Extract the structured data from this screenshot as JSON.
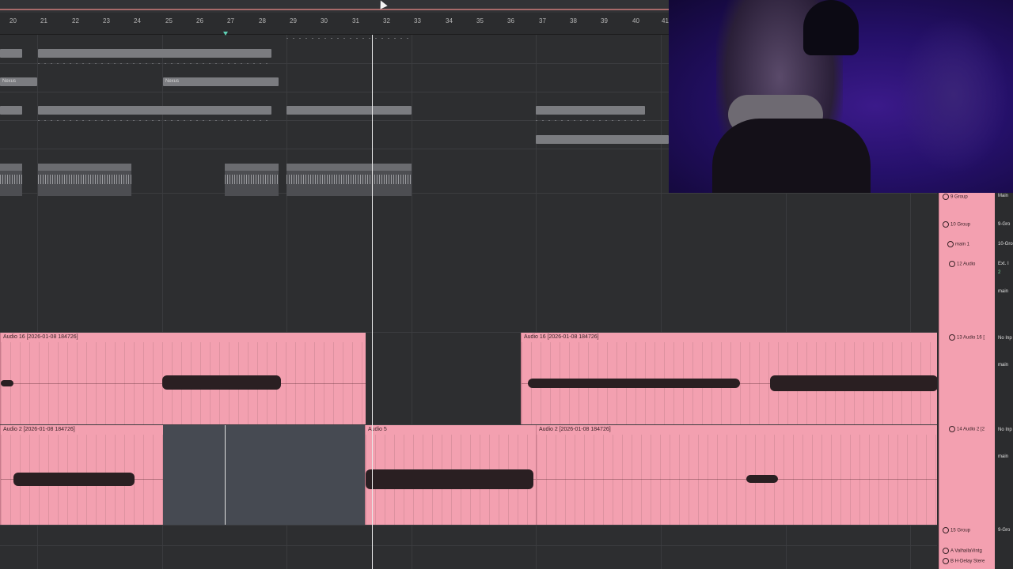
{
  "ruler": {
    "bars": [
      "20",
      "21",
      "22",
      "23",
      "24",
      "25",
      "26",
      "27",
      "28",
      "29",
      "30",
      "31",
      "32",
      "33",
      "34",
      "35",
      "36",
      "37",
      "38",
      "39",
      "40",
      "41"
    ]
  },
  "grey_clips": [
    {
      "label": "Nexus"
    },
    {
      "label": "Nexus"
    }
  ],
  "drum_clips": [
    {
      "label": "clasy"
    },
    {
      "label": "clasy_101_drumloop_90bpm_Re"
    },
    {
      "label": "clasy_101_drumlo"
    },
    {
      "label": "clasy_101_drumloop_100bpm_fersceclipsis"
    }
  ],
  "audio_clips": [
    {
      "label": "Audio 16 [2026-01-08 184726]"
    },
    {
      "label": "Audio 16 [2026-01-08 184726]"
    },
    {
      "label": "Audio 2 [2026-01-08 184726]"
    },
    {
      "label": "Audio 5"
    },
    {
      "label": "Audio 2 [2026-01-08 184726]"
    }
  ],
  "mixer": {
    "tracks": [
      {
        "label": "9 Group"
      },
      {
        "label": "10 Group"
      },
      {
        "label": "main 1"
      },
      {
        "label": "12 Audio"
      },
      {
        "label": "13 Audio 16 ["
      },
      {
        "label": "14 Audio 2 [2"
      },
      {
        "label": "15 Group"
      },
      {
        "label": "A ValhallaVintg"
      },
      {
        "label": "B H-Delay Stere"
      }
    ],
    "io": [
      "Main",
      "9-Gro",
      "10-Gro",
      "Ext. I",
      "2",
      "main",
      "No Inp",
      "main",
      "No Inp",
      "main",
      "9-Gro"
    ]
  },
  "colors": {
    "audio_clip": "#f3a0b0",
    "playhead": "#e8e8e8",
    "grey_clip": "#7b7c80",
    "arrange_bg": "#2d2e30"
  }
}
